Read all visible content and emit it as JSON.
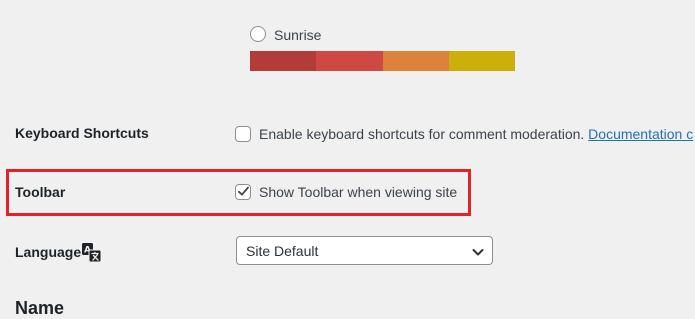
{
  "color_scheme": {
    "option_label": "Sunrise",
    "swatches": [
      "#b43c38",
      "#cf4944",
      "#dd823b",
      "#ccaf0b"
    ]
  },
  "keyboard_shortcuts": {
    "label": "Keyboard Shortcuts",
    "checkbox_text": "Enable keyboard shortcuts for comment moderation.",
    "link_text": "Documentation c",
    "checked": false
  },
  "toolbar": {
    "label": "Toolbar",
    "checkbox_text": "Show Toolbar when viewing site",
    "checked": true
  },
  "language": {
    "label": "Language",
    "icon": "translation-icon",
    "selected": "Site Default"
  },
  "name_section": {
    "title": "Name"
  },
  "colors": {
    "highlight": "#e32228",
    "link": "#2271b1",
    "background": "#f0f0f1"
  }
}
